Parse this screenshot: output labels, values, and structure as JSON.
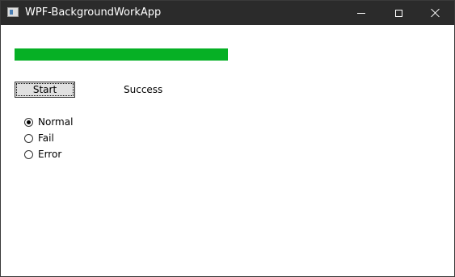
{
  "window": {
    "title": "WPF-BackgroundWorkApp"
  },
  "caption_buttons": {
    "minimize_icon": "minimize-icon",
    "maximize_icon": "maximize-icon",
    "close_icon": "close-icon"
  },
  "progress": {
    "value_percent": 100,
    "color": "#06b025"
  },
  "controls": {
    "start_label": "Start",
    "status_text": "Success"
  },
  "radio_options": [
    {
      "label": "Normal",
      "checked": true
    },
    {
      "label": "Fail",
      "checked": false
    },
    {
      "label": "Error",
      "checked": false
    }
  ]
}
